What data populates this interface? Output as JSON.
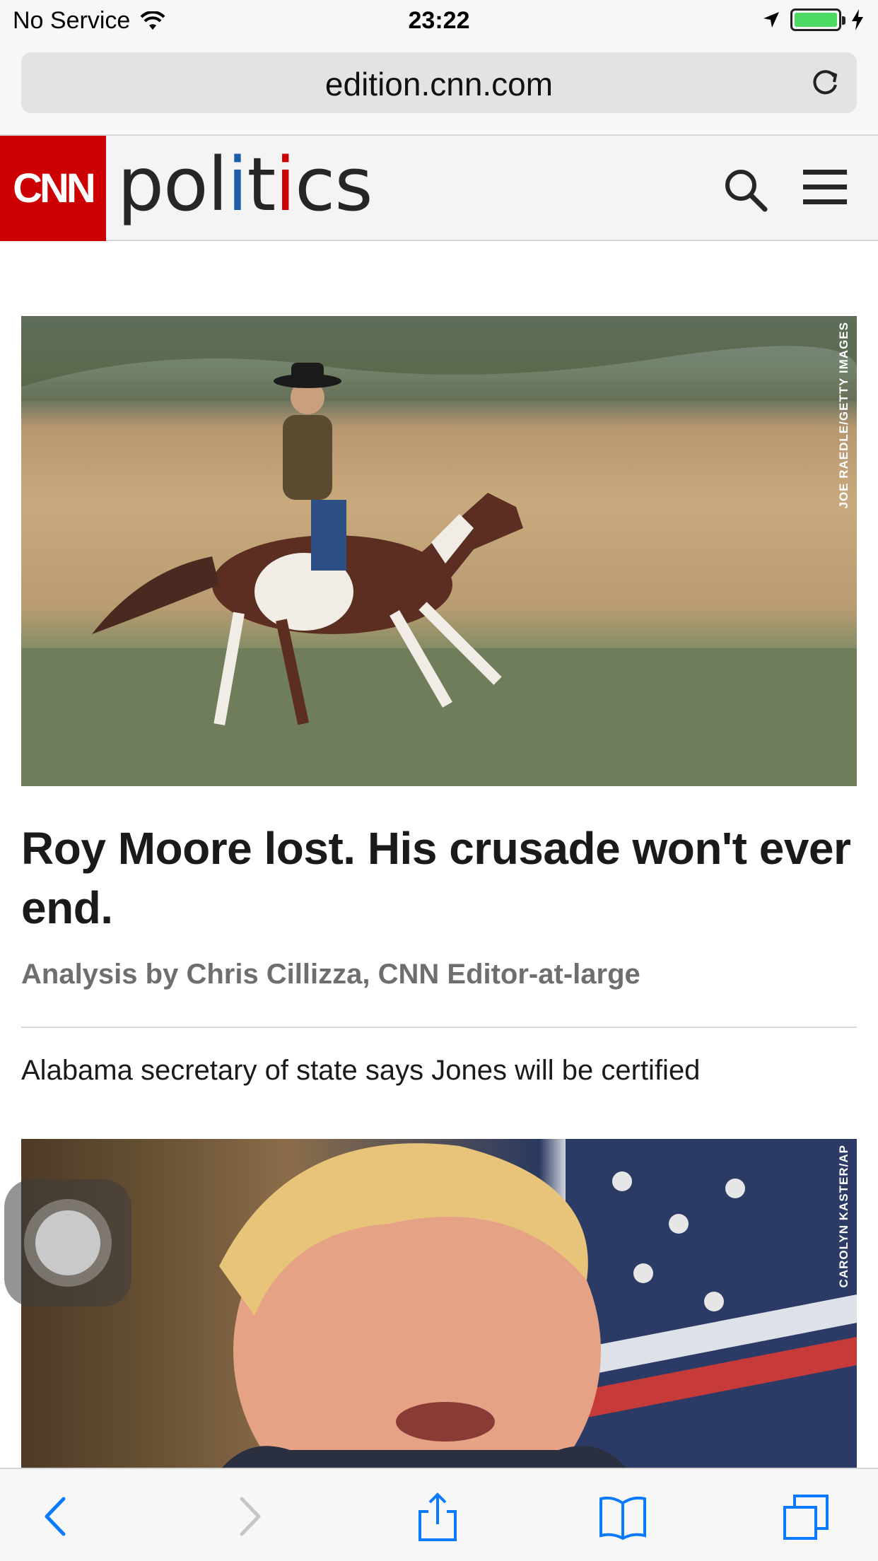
{
  "status_bar": {
    "carrier": "No Service",
    "time": "23:22",
    "battery_level": 1.0
  },
  "browser": {
    "url": "edition.cnn.com"
  },
  "site_header": {
    "logo_text": "CNN",
    "section_parts": [
      "pol",
      "i",
      "t",
      "i",
      "cs"
    ]
  },
  "article": {
    "image_credit": "JOE RAEDLE/GETTY IMAGES",
    "headline": "Roy Moore lost. His crusade won't ever end.",
    "byline": "Analysis by Chris Cillizza, CNN Editor-at-large",
    "related_link": "Alabama secretary of state says Jones will be certified"
  },
  "second_story": {
    "image_credit": "CAROLYN KASTER/AP"
  },
  "icons": {
    "wifi": "wifi-icon",
    "location": "location-arrow-icon",
    "charging": "bolt-icon",
    "reload": "reload-icon",
    "search": "search-icon",
    "menu": "hamburger-menu-icon",
    "back": "chevron-left-icon",
    "forward": "chevron-right-icon",
    "share": "share-icon",
    "bookmarks": "book-icon",
    "tabs": "tabs-icon"
  },
  "colors": {
    "cnn_red": "#cc0000",
    "politics_blue": "#1c5cab",
    "ios_blue": "#0a7aff",
    "battery_green": "#4cd964"
  }
}
